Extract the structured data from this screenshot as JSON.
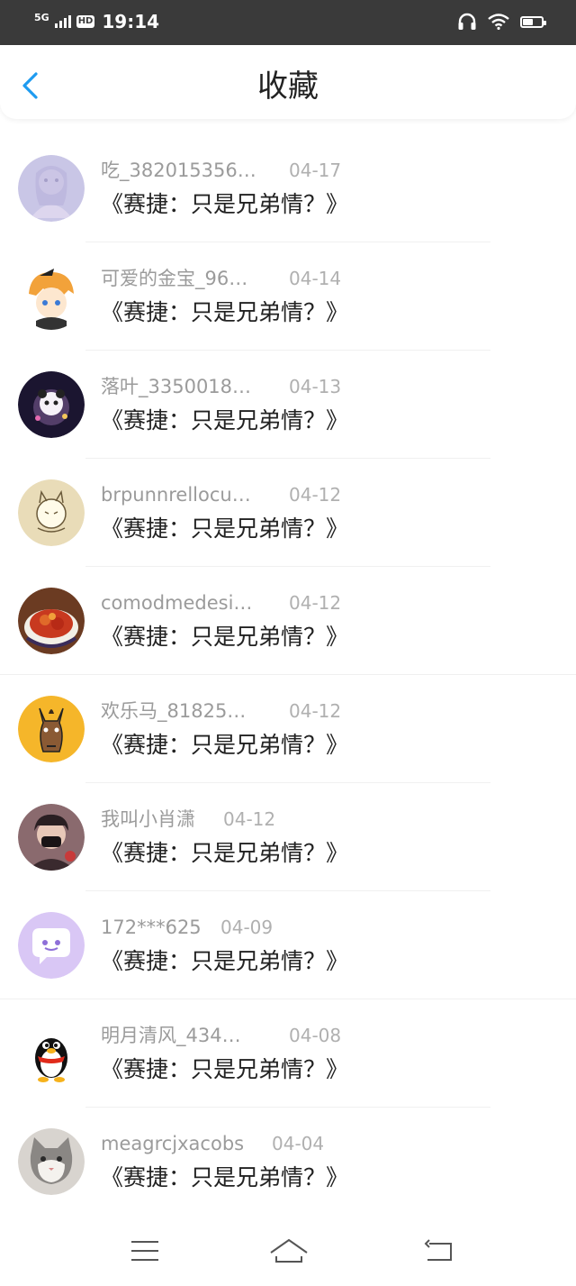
{
  "status_bar": {
    "network": "5G",
    "hd": "HD",
    "time": "19:14",
    "icons": [
      "signal-icon",
      "headphones-icon",
      "wifi-icon",
      "battery-icon"
    ],
    "battery_level": 0.55
  },
  "header": {
    "title": "收藏",
    "back_icon": "chevron-left-icon",
    "accent_color": "#1e9bf0"
  },
  "items": [
    {
      "name": "吃_382015356…",
      "date": "04-17",
      "title": "《赛捷：只是兄弟情？》",
      "avatar": "anime-girl-avatar"
    },
    {
      "name": "可爱的金宝_96…",
      "date": "04-14",
      "title": "《赛捷：只是兄弟情？》",
      "avatar": "anime-boy-avatar"
    },
    {
      "name": "落叶_3350018…",
      "date": "04-13",
      "title": "《赛捷：只是兄弟情？》",
      "avatar": "panda-avatar"
    },
    {
      "name": "brpunnrellocu…",
      "date": "04-12",
      "title": "《赛捷：只是兄弟情？》",
      "avatar": "cartoon-cat-avatar"
    },
    {
      "name": "comodmedesi…",
      "date": "04-12",
      "title": "《赛捷：只是兄弟情？》",
      "avatar": "food-avatar"
    },
    {
      "name": "欢乐马_81825…",
      "date": "04-12",
      "title": "《赛捷：只是兄弟情？》",
      "avatar": "horse-avatar"
    },
    {
      "name": "我叫小肖潇",
      "date": "04-12",
      "title": "《赛捷：只是兄弟情？》",
      "avatar": "person-avatar"
    },
    {
      "name": "172***625",
      "date": "04-09",
      "title": "《赛捷：只是兄弟情？》",
      "avatar": "chat-bubble-avatar"
    },
    {
      "name": "明月清风_434…",
      "date": "04-08",
      "title": "《赛捷：只是兄弟情？》",
      "avatar": "qq-penguin-avatar"
    },
    {
      "name": "meagrcjxacobs",
      "date": "04-04",
      "title": "《赛捷：只是兄弟情？》",
      "avatar": "cat-photo-avatar"
    }
  ],
  "nav_bar": {
    "icons": [
      "menu-icon",
      "home-icon",
      "back-icon"
    ]
  }
}
